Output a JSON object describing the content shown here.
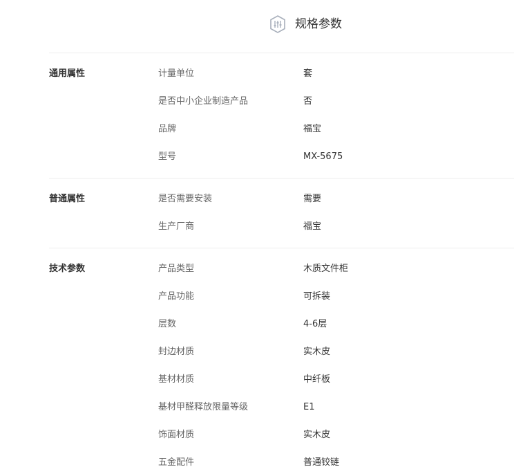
{
  "header": {
    "icon": "sliders-icon",
    "title": "规格参数"
  },
  "groups": [
    {
      "title": "通用属性",
      "rows": [
        {
          "label": "计量单位",
          "value": "套"
        },
        {
          "label": "是否中小企业制造产品",
          "value": "否"
        },
        {
          "label": "品牌",
          "value": "福宝"
        },
        {
          "label": "型号",
          "value": "MX-5675"
        }
      ]
    },
    {
      "title": "普通属性",
      "rows": [
        {
          "label": "是否需要安装",
          "value": "需要"
        },
        {
          "label": "生产厂商",
          "value": "福宝"
        }
      ]
    },
    {
      "title": "技术参数",
      "rows": [
        {
          "label": "产品类型",
          "value": "木质文件柜"
        },
        {
          "label": "产品功能",
          "value": "可拆装"
        },
        {
          "label": "层数",
          "value": "4-6层"
        },
        {
          "label": "封边材质",
          "value": "实木皮"
        },
        {
          "label": "基材材质",
          "value": "中纤板"
        },
        {
          "label": "基材甲醛释放限量等级",
          "value": "E1"
        },
        {
          "label": "饰面材质",
          "value": "实木皮"
        },
        {
          "label": "五金配件",
          "value": "普通铰链"
        }
      ]
    }
  ]
}
